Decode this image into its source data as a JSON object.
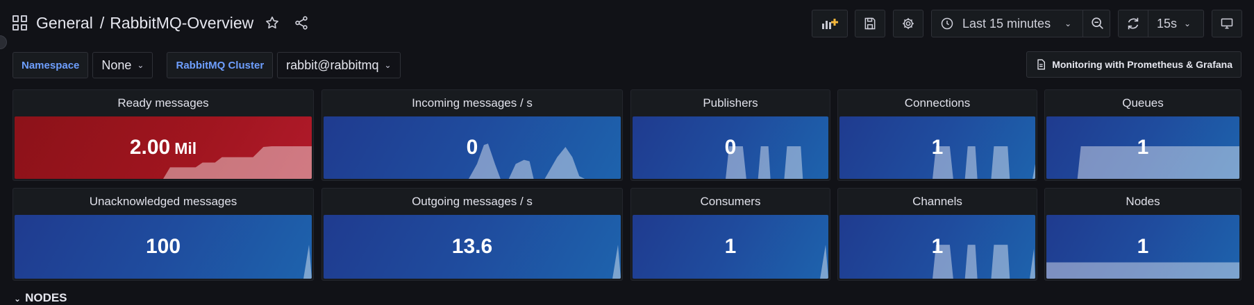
{
  "header": {
    "breadcrumb_folder": "General",
    "breadcrumb_separator": "/",
    "dashboard_title": "RabbitMQ-Overview"
  },
  "toolbar": {
    "time_range": "Last 15 minutes",
    "refresh_interval": "15s"
  },
  "variables": [
    {
      "label": "Namespace",
      "value": "None"
    },
    {
      "label": "RabbitMQ Cluster",
      "value": "rabbit@rabbitmq"
    }
  ],
  "links": {
    "monitoring": "Monitoring with Prometheus & Grafana"
  },
  "panels": [
    {
      "title": "Ready messages",
      "value": "2.00",
      "unit": "Mil",
      "color": "red"
    },
    {
      "title": "Incoming messages / s",
      "value": "0",
      "unit": "",
      "color": "blue"
    },
    {
      "title": "Publishers",
      "value": "0",
      "unit": "",
      "color": "blue"
    },
    {
      "title": "Connections",
      "value": "1",
      "unit": "",
      "color": "blue"
    },
    {
      "title": "Queues",
      "value": "1",
      "unit": "",
      "color": "blue"
    },
    {
      "title": "Unacknowledged messages",
      "value": "100",
      "unit": "",
      "color": "blue"
    },
    {
      "title": "Outgoing messages / s",
      "value": "13.6",
      "unit": "",
      "color": "blue"
    },
    {
      "title": "Consumers",
      "value": "1",
      "unit": "",
      "color": "blue"
    },
    {
      "title": "Channels",
      "value": "1",
      "unit": "",
      "color": "blue"
    },
    {
      "title": "Nodes",
      "value": "1",
      "unit": "",
      "color": "blue"
    }
  ],
  "section": {
    "title": "NODES"
  },
  "colors": {
    "background": "#111217",
    "panel_blue": "#1f4c9e",
    "panel_red": "#a0151f",
    "variable_label": "#6e9fff"
  }
}
